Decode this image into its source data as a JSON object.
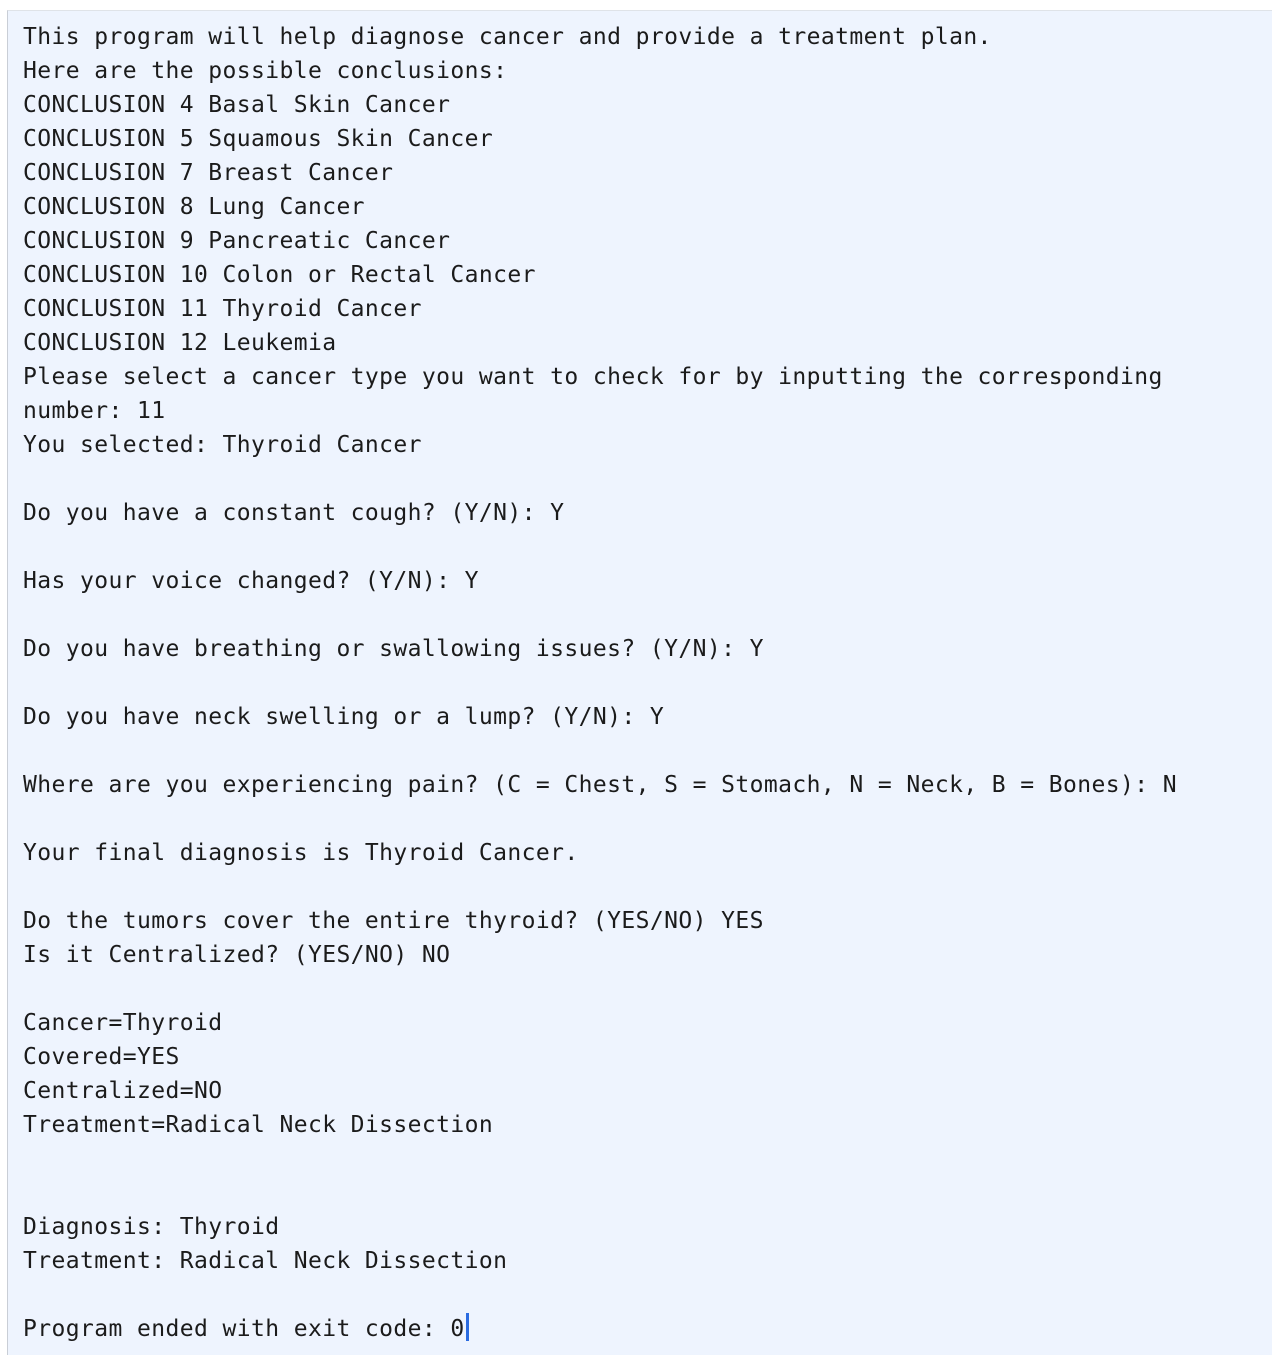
{
  "console": {
    "lines": [
      "This program will help diagnose cancer and provide a treatment plan.",
      "Here are the possible conclusions:",
      "CONCLUSION 4 Basal Skin Cancer",
      "CONCLUSION 5 Squamous Skin Cancer",
      "CONCLUSION 7 Breast Cancer",
      "CONCLUSION 8 Lung Cancer",
      "CONCLUSION 9 Pancreatic Cancer",
      "CONCLUSION 10 Colon or Rectal Cancer",
      "CONCLUSION 11 Thyroid Cancer",
      "CONCLUSION 12 Leukemia",
      "Please select a cancer type you want to check for by inputting the corresponding",
      "number: 11",
      "You selected: Thyroid Cancer",
      "",
      "Do you have a constant cough? (Y/N): Y",
      "",
      "Has your voice changed? (Y/N): Y",
      "",
      "Do you have breathing or swallowing issues? (Y/N): Y",
      "",
      "Do you have neck swelling or a lump? (Y/N): Y",
      "",
      "Where are you experiencing pain? (C = Chest, S = Stomach, N = Neck, B = Bones): N",
      "",
      "Your final diagnosis is Thyroid Cancer.",
      "",
      "Do the tumors cover the entire thyroid? (YES/NO) YES",
      "Is it Centralized? (YES/NO) NO",
      "",
      "Cancer=Thyroid",
      "Covered=YES",
      "Centralized=NO",
      "Treatment=Radical Neck Dissection",
      "",
      "",
      "Diagnosis: Thyroid",
      "Treatment: Radical Neck Dissection",
      "",
      "Program ended with exit code: 0"
    ]
  }
}
